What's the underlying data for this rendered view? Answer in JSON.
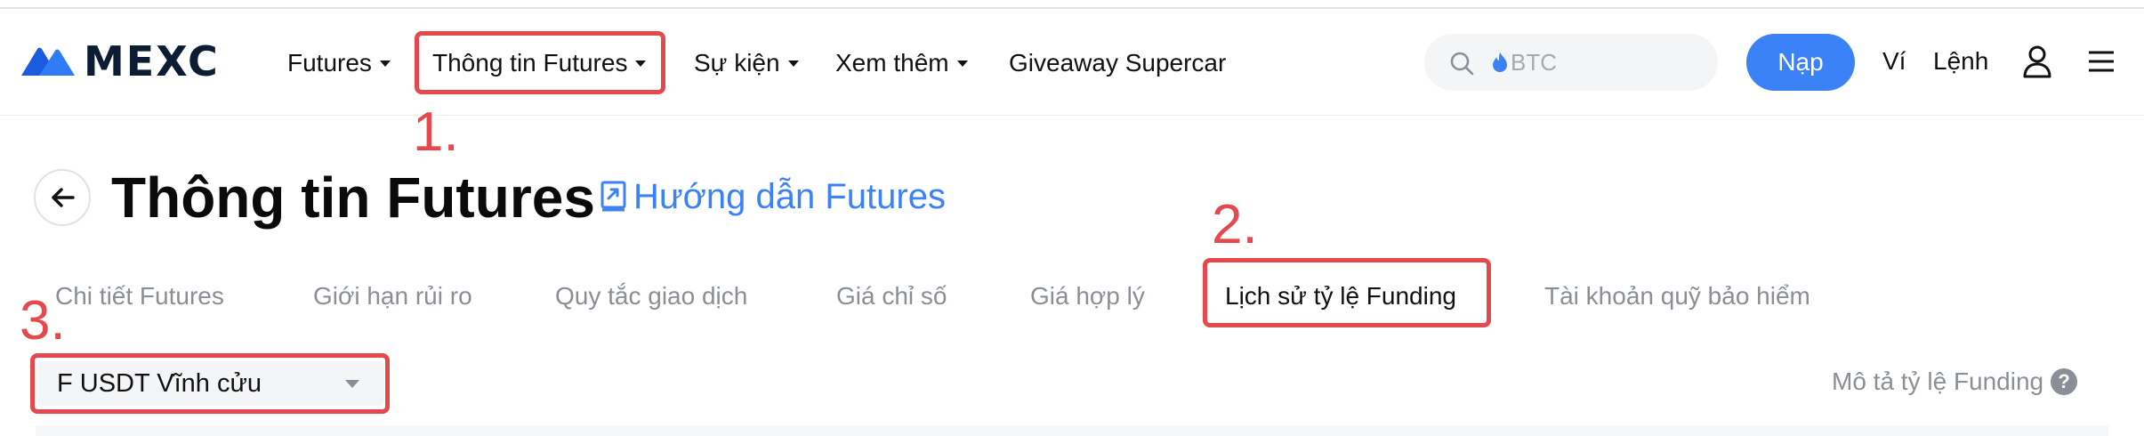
{
  "header": {
    "logo_text": "MEXC",
    "nav": [
      {
        "label": "Futures",
        "has_caret": true
      },
      {
        "label": "Thông tin Futures",
        "has_caret": true
      },
      {
        "label": "Sự kiện",
        "has_caret": true
      },
      {
        "label": "Xem thêm",
        "has_caret": true
      },
      {
        "label": "Giveaway Supercar",
        "has_caret": false
      }
    ],
    "search": {
      "placeholder": "BTC",
      "icon": "search-icon",
      "hot_icon": "flame-icon"
    },
    "deposit_label": "Nạp",
    "wallet_label": "Ví",
    "orders_label": "Lệnh",
    "user_icon": "user-icon",
    "menu_icon": "hamburger-menu-icon"
  },
  "page": {
    "title": "Thông tin Futures",
    "guide_link": "Hướng dẫn Futures"
  },
  "tabs": [
    {
      "label": "Chi tiết Futures",
      "active": false
    },
    {
      "label": "Giới hạn rủi ro",
      "active": false
    },
    {
      "label": "Quy tắc giao dịch",
      "active": false
    },
    {
      "label": "Giá chỉ số",
      "active": false
    },
    {
      "label": "Giá hợp lý",
      "active": false
    },
    {
      "label": "Lịch sử tỷ lệ Funding",
      "active": true
    },
    {
      "label": "Tài khoản quỹ bảo hiểm",
      "active": false
    }
  ],
  "contract_select": {
    "value": "F USDT Vĩnh cửu"
  },
  "funding_description": "Mô tả tỷ lệ Funding",
  "help_glyph": "?",
  "annotations": [
    "1.",
    "2.",
    "3."
  ],
  "colors": {
    "accent": "#3b82f6",
    "annotation": "#e5484d",
    "logo": "#0b1c33"
  }
}
